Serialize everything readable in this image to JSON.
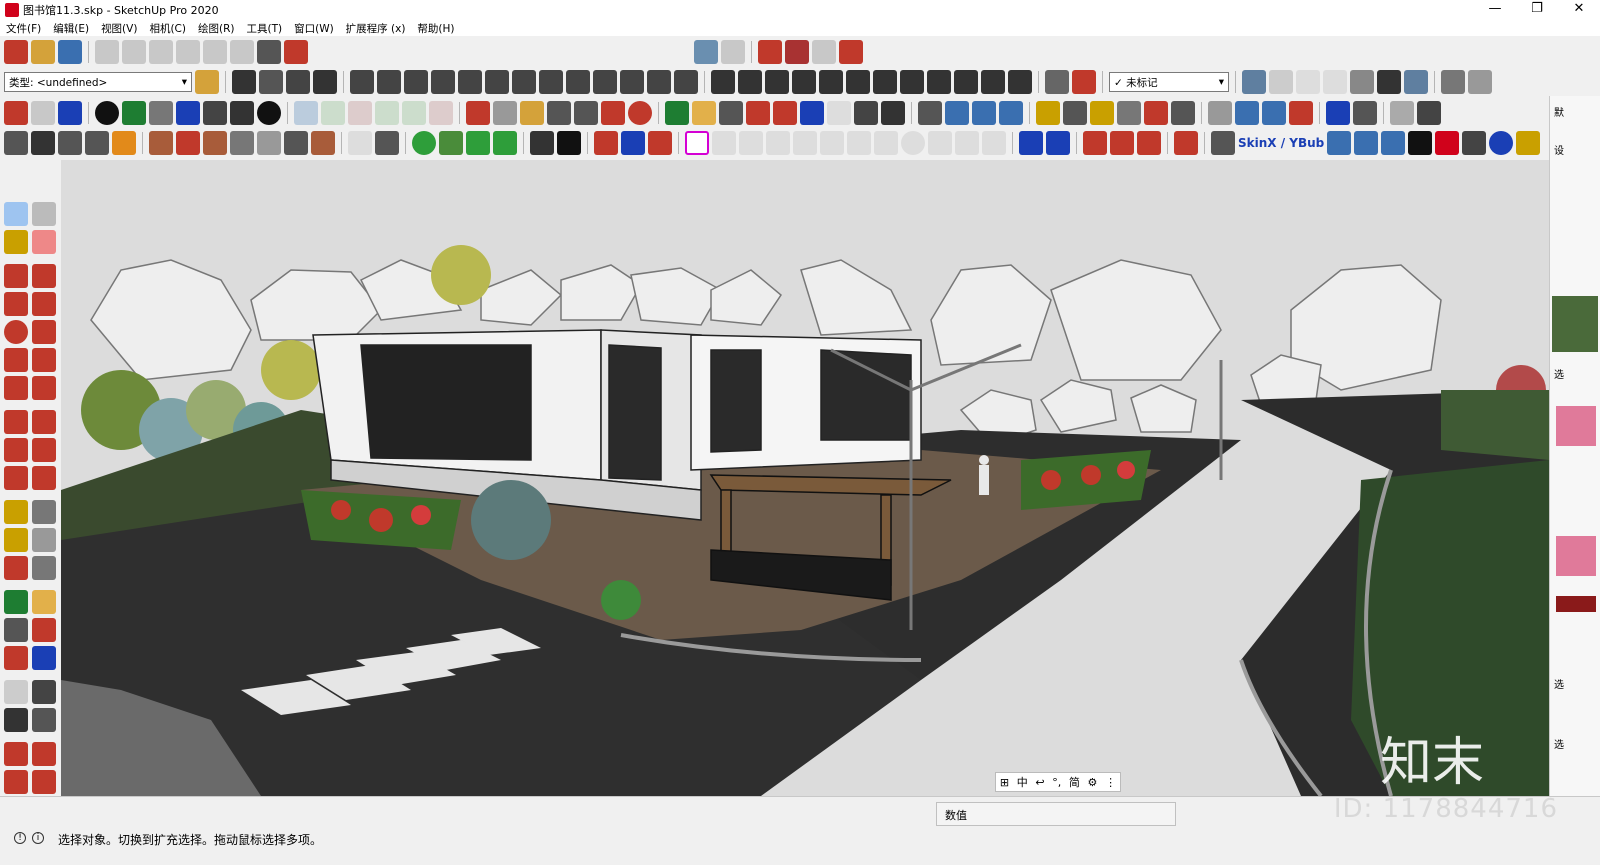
{
  "window": {
    "title": "图书馆11.3.skp - SketchUp Pro 2020",
    "controls": [
      "—",
      "❐",
      "✕"
    ]
  },
  "menu": [
    "文件(F)",
    "编辑(E)",
    "视图(V)",
    "相机(C)",
    "绘图(R)",
    "工具(T)",
    "窗口(W)",
    "扩展程序 (x)",
    "帮助(H)"
  ],
  "toolbar": {
    "type_label": "类型: <undefined>",
    "layer_label": "✓ 未标记",
    "skinx_label": "SkinX / YBub"
  },
  "right_panel": {
    "label_top": "默",
    "label_2": "设",
    "label_3": "选",
    "label_4": "选",
    "label_5": "选"
  },
  "ime": {
    "items": [
      "⊞",
      "中",
      "↩",
      "°,",
      "简",
      "⚙",
      "⋮"
    ]
  },
  "status": {
    "message": "选择对象。切换到扩充选择。拖动鼠标选择多项。",
    "measure_label": "数值"
  },
  "watermark": {
    "id_text": "ID: 1178844716",
    "logo_text": "知末"
  },
  "colors": {
    "sky": "#dcdcdc",
    "road": "#2b2b2b",
    "grass": "#2f4a2a",
    "paving": "#6b5a4a",
    "accent_red": "#d0021b"
  }
}
